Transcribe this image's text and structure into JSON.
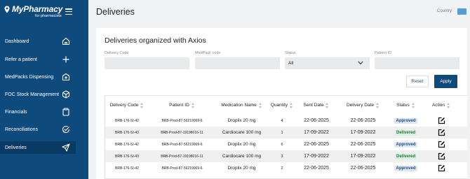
{
  "app": {
    "logo_main": "MyPharmacy",
    "logo_sub": "for pharmacists"
  },
  "sidebar": {
    "items": [
      {
        "label": "Dashboard",
        "icon": "home-icon",
        "active": false
      },
      {
        "label": "Refer a patient",
        "icon": "plus-icon",
        "active": false
      },
      {
        "label": "MedPacks Dispensing",
        "icon": "box-plus-icon",
        "active": false
      },
      {
        "label": "FOC Stock Management",
        "icon": "cube-icon",
        "active": false
      },
      {
        "label": "Financials",
        "icon": "clipboard-icon",
        "active": false
      },
      {
        "label": "Reconciliations",
        "icon": "check-circle-icon",
        "active": false
      },
      {
        "label": "Deliveries",
        "icon": "send-icon",
        "active": true
      }
    ]
  },
  "header": {
    "title": "Deliveries",
    "country_label": "Country"
  },
  "card": {
    "title": "Deliveries organized with Axios"
  },
  "filters": {
    "delivery_code": {
      "label": "Delivery Code",
      "value": ""
    },
    "medpack_code": {
      "label": "MedPack code",
      "value": ""
    },
    "status": {
      "label": "Status",
      "value": "All"
    },
    "patient_id": {
      "label": "Patient ID",
      "value": ""
    },
    "reset_label": "Reset",
    "apply_label": "Apply"
  },
  "table": {
    "columns": [
      "Delivery Code",
      "Patient ID",
      "Medication Name",
      "Quantity",
      "Sent Date",
      "Delivery Date",
      "Status",
      "Action"
    ],
    "rows": [
      {
        "delivery_code": "BRB-176-SI-42",
        "patient_id": "BRB-Prod-87-56219069-6",
        "medication": "Droplix 20 mg",
        "quantity": "4",
        "sent_date": "22-06-2025",
        "delivery_date": "22-06-2025",
        "status": "Approved"
      },
      {
        "delivery_code": "BRB-176-SI-43",
        "patient_id": "BRB-Prod-87-19198016-11",
        "medication": "Cardiocare 100 mg",
        "quantity": "1",
        "sent_date": "17-09-2022",
        "delivery_date": "17-09-2022",
        "status": "Delivered"
      },
      {
        "delivery_code": "BRB-176-SI-42",
        "patient_id": "BRB-Prod-87-56219069-6",
        "medication": "Droplix 20 mg",
        "quantity": "6",
        "sent_date": "22-06-2025",
        "delivery_date": "22-06-2025",
        "status": "Approved"
      },
      {
        "delivery_code": "BRB-176-SI-43",
        "patient_id": "BRB-Prod-87-19198016-11",
        "medication": "Cardiocare 100 mg",
        "quantity": "3",
        "sent_date": "17-09-2022",
        "delivery_date": "17-09-2022",
        "status": "Delivered"
      },
      {
        "delivery_code": "BRB-176-SI-42",
        "patient_id": "BRB-Prod-87-56219069-6",
        "medication": "Droplix 20 mg",
        "quantity": "2",
        "sent_date": "22-06-2025",
        "delivery_date": "22-06-2025",
        "status": "Approved"
      }
    ]
  },
  "colors": {
    "sidebar": "#0f4a7c",
    "sidebar_active": "#0a3a63",
    "apply_button": "#0f4a7c",
    "approved_bg": "#dde7f7",
    "approved_text": "#1d4f83",
    "delivered_bg": "#d9f2df",
    "delivered_text": "#1e7a3a"
  }
}
